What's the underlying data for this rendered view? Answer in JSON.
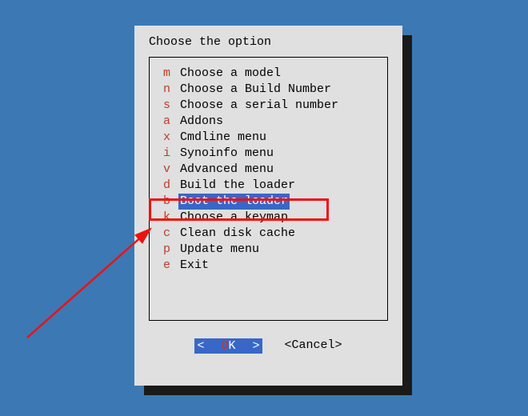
{
  "title": "Choose the option",
  "items": [
    {
      "key": "m",
      "label": "Choose a model",
      "selected": false
    },
    {
      "key": "n",
      "label": "Choose a Build Number",
      "selected": false
    },
    {
      "key": "s",
      "label": "Choose a serial number",
      "selected": false
    },
    {
      "key": "a",
      "label": "Addons",
      "selected": false
    },
    {
      "key": "x",
      "label": "Cmdline menu",
      "selected": false
    },
    {
      "key": "i",
      "label": "Synoinfo menu",
      "selected": false
    },
    {
      "key": "v",
      "label": "Advanced menu",
      "selected": false
    },
    {
      "key": "d",
      "label": "Build the loader",
      "selected": false
    },
    {
      "key": "b",
      "label": "Boot the loader",
      "selected": true
    },
    {
      "key": "k",
      "label": "Choose a keymap",
      "selected": false
    },
    {
      "key": "c",
      "label": "Clean disk cache",
      "selected": false
    },
    {
      "key": "p",
      "label": "Update menu",
      "selected": false
    },
    {
      "key": "e",
      "label": "Exit",
      "selected": false
    }
  ],
  "ok": {
    "angleL": "<",
    "angleR": ">",
    "O": "O",
    "K": "K"
  },
  "cancel": "<Cancel>"
}
